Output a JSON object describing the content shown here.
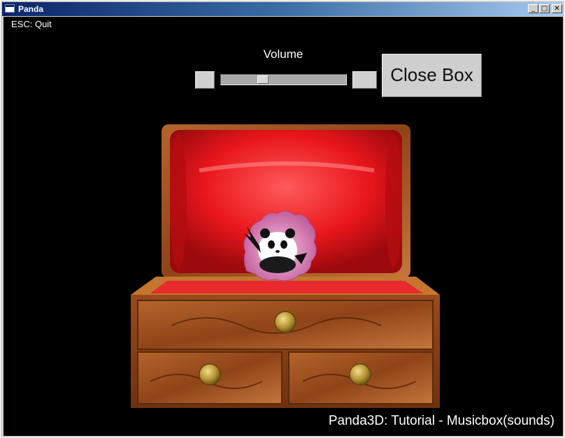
{
  "window": {
    "title": "Panda",
    "controls": {
      "minimize": "_",
      "maximize": "□",
      "close": "✕"
    }
  },
  "hud": {
    "esc_hint": "ESC: Quit",
    "volume_label": "Volume",
    "volume_level": 0.32,
    "close_box_label": "Close Box",
    "caption": "Panda3D: Tutorial - Musicbox(sounds)"
  },
  "icons": {
    "app": "panda-window-icon",
    "minimize": "minimize-icon",
    "maximize": "maximize-icon",
    "close": "close-icon"
  },
  "colors": {
    "lid_lining": "#e8161c",
    "wood": "#a3501c",
    "brass": "#b99636",
    "tutu": "#d77fb1"
  }
}
